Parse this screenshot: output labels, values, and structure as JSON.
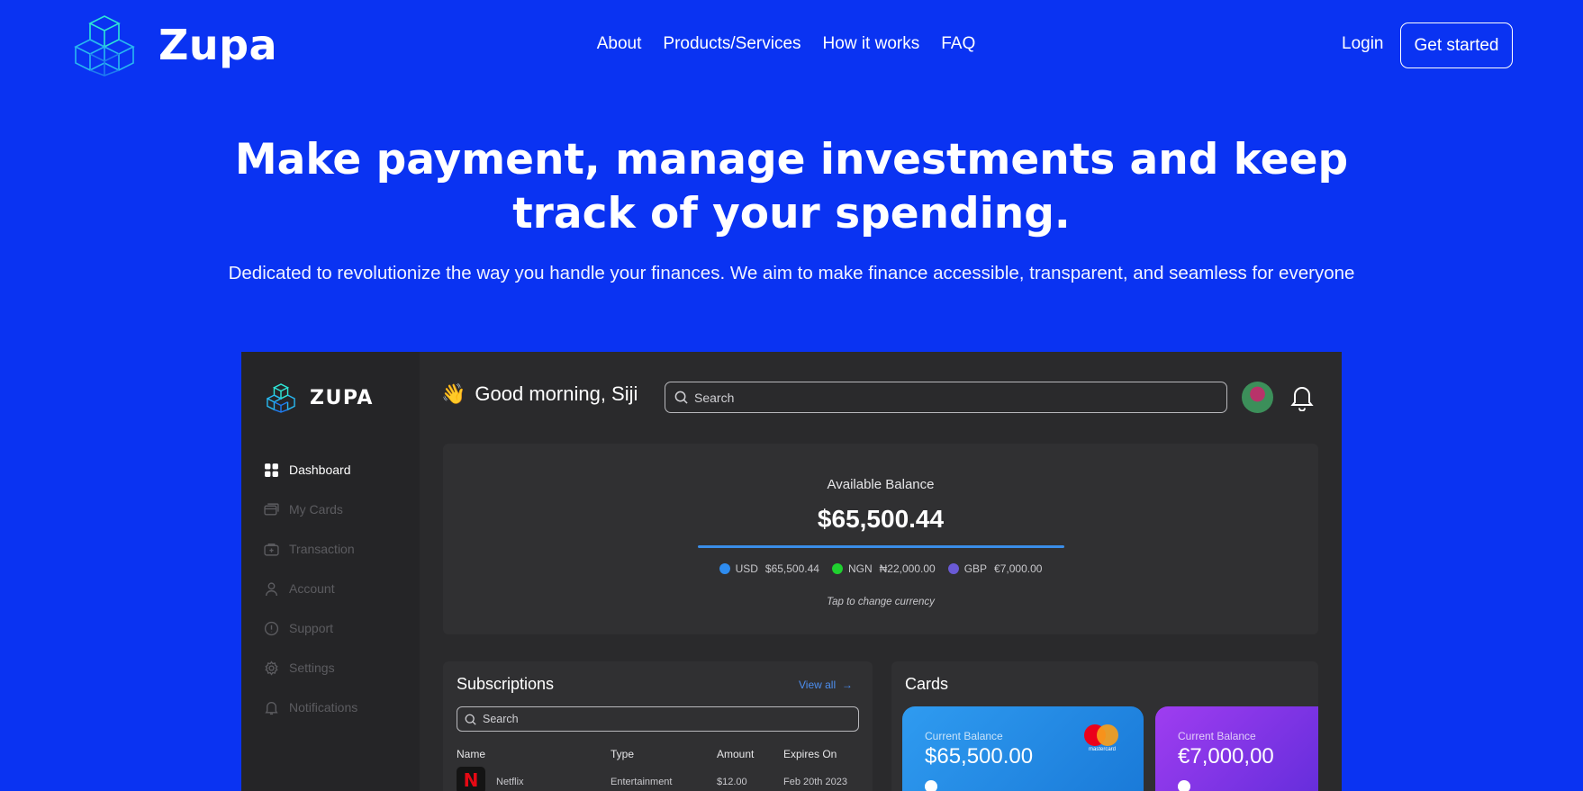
{
  "nav": {
    "brand": "Zupa",
    "links": [
      "About",
      "Products/Services",
      "How it works",
      "FAQ"
    ],
    "login": "Login",
    "cta": "Get started"
  },
  "hero": {
    "title_line1": "Make payment, manage investments and keep",
    "title_line2": "track of your spending.",
    "subtitle": "Dedicated to  revolutionize the way you handle your finances. We aim to make finance accessible, transparent, and seamless for everyone"
  },
  "dashboard": {
    "brand": "ZUPA",
    "sidebar": [
      {
        "label": "Dashboard",
        "icon": "grid-icon",
        "active": true
      },
      {
        "label": "My Cards",
        "icon": "card-icon",
        "active": false
      },
      {
        "label": "Transaction",
        "icon": "wallet-icon",
        "active": false
      },
      {
        "label": "Account",
        "icon": "user-icon",
        "active": false
      },
      {
        "label": "Support",
        "icon": "info-icon",
        "active": false
      },
      {
        "label": "Settings",
        "icon": "gear-icon",
        "active": false
      },
      {
        "label": "Notifications",
        "icon": "bell-icon",
        "active": false
      }
    ],
    "greeting_emoji": "👋",
    "greeting": "Good morning, Siji",
    "search_placeholder": "Search",
    "balance": {
      "label": "Available Balance",
      "value": "$65,500.44",
      "currencies": [
        {
          "code": "USD",
          "amount": "$65,500.44",
          "color": "#2e8cf0"
        },
        {
          "code": "NGN",
          "amount": "₦22,000.00",
          "color": "#1fd12f"
        },
        {
          "code": "GBP",
          "amount": "€7,000.00",
          "color": "#6a5ad6"
        }
      ],
      "hint": "Tap to change currency"
    },
    "subscriptions": {
      "title": "Subscriptions",
      "view_all": "View all",
      "search_placeholder": "Search",
      "columns": [
        "Name",
        "Type",
        "Amount",
        "Expires On"
      ],
      "rows": [
        {
          "logo": "N",
          "name": "Netflix",
          "type": "Entertainment",
          "amount": "$12.00",
          "expires": "Feb 20th 2023"
        }
      ]
    },
    "cards": {
      "title": "Cards",
      "items": [
        {
          "label": "Current Balance",
          "value": "$65,500.00",
          "brand": "mastercard"
        },
        {
          "label": "Current Balance",
          "value": "€7,000,00"
        }
      ]
    }
  }
}
